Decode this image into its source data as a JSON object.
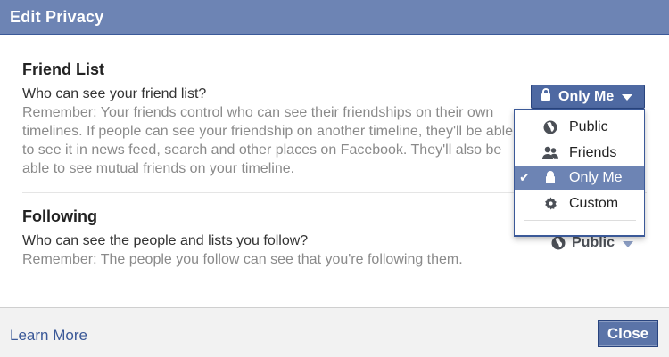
{
  "dialog": {
    "title": "Edit Privacy"
  },
  "friend_list": {
    "heading": "Friend List",
    "question": "Who can see your friend list?",
    "note": "Remember: Your friends control who can see their friendships on their own timelines. If people can see your friendship on another timeline, they'll be able to see it in news feed, search and other places on Facebook. They'll also be able to see mutual friends on your timeline.",
    "privacy_value": "Only Me",
    "privacy_icon": "lock-icon"
  },
  "following": {
    "heading": "Following",
    "question": "Who can see the people and lists you follow?",
    "note": "Remember: The people you follow can see that you're following them.",
    "privacy_value": "Public",
    "privacy_icon": "globe-icon"
  },
  "menu": {
    "items": [
      {
        "label": "Public",
        "icon": "globe-icon",
        "selected": false
      },
      {
        "label": "Friends",
        "icon": "friends-icon",
        "selected": false
      },
      {
        "label": "Only Me",
        "icon": "lock-icon",
        "selected": true
      },
      {
        "label": "Custom",
        "icon": "gear-icon",
        "selected": false
      }
    ],
    "check_glyph": "✔"
  },
  "footer": {
    "learn_more": "Learn More",
    "close_label": "Close"
  },
  "colors": {
    "header": "#6d84b4",
    "selected": "#6d84b4",
    "link": "#3b5998",
    "button": "#4e69a2"
  }
}
